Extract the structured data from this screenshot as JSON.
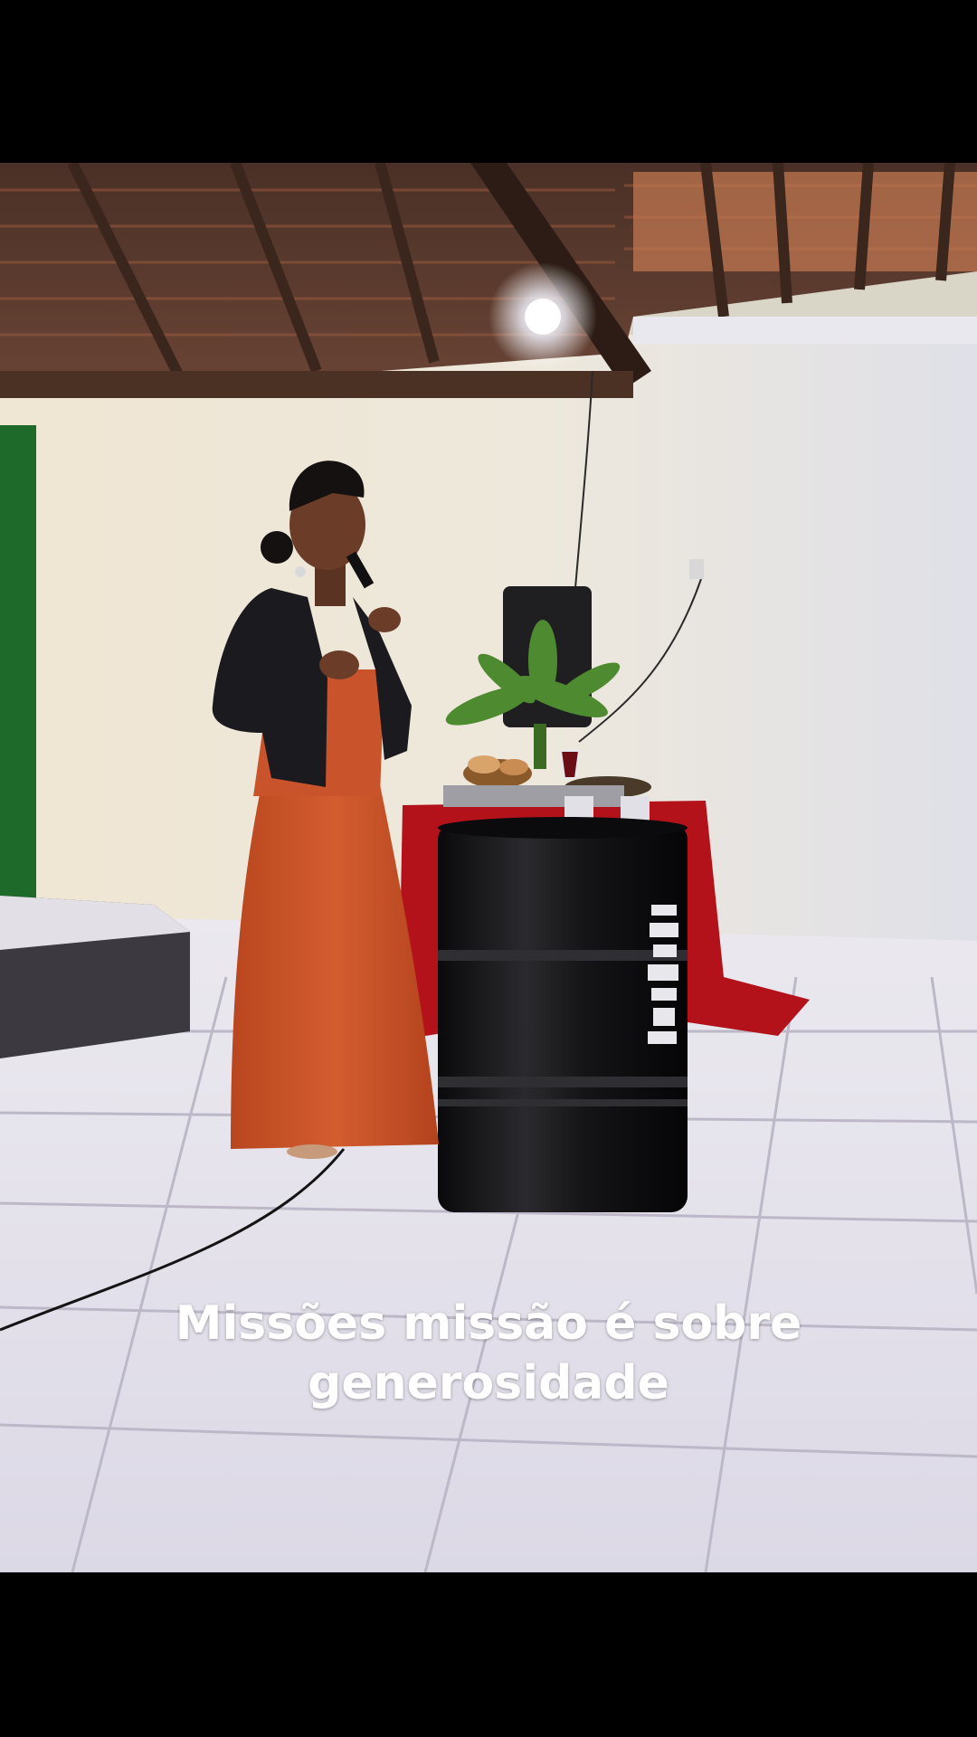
{
  "caption": {
    "line1": "Missões missão é sobre",
    "line2": "generosidade"
  },
  "colors": {
    "letterbox": "#000000",
    "caption_text": "#ffffff",
    "wall": "#e8e2d2",
    "floor": "#e9e6ef",
    "dress": "#c9532a",
    "jacket": "#1b1b1f",
    "tablecloth": "#b3121b",
    "barrel": "#121214",
    "curtain": "#1d6a2a"
  },
  "scene": {
    "subject": "woman-speaking-with-microphone",
    "props": [
      "speaker-cabinet",
      "plant",
      "wine-glass",
      "bread-basket",
      "barrel-table",
      "red-tablecloth"
    ]
  }
}
